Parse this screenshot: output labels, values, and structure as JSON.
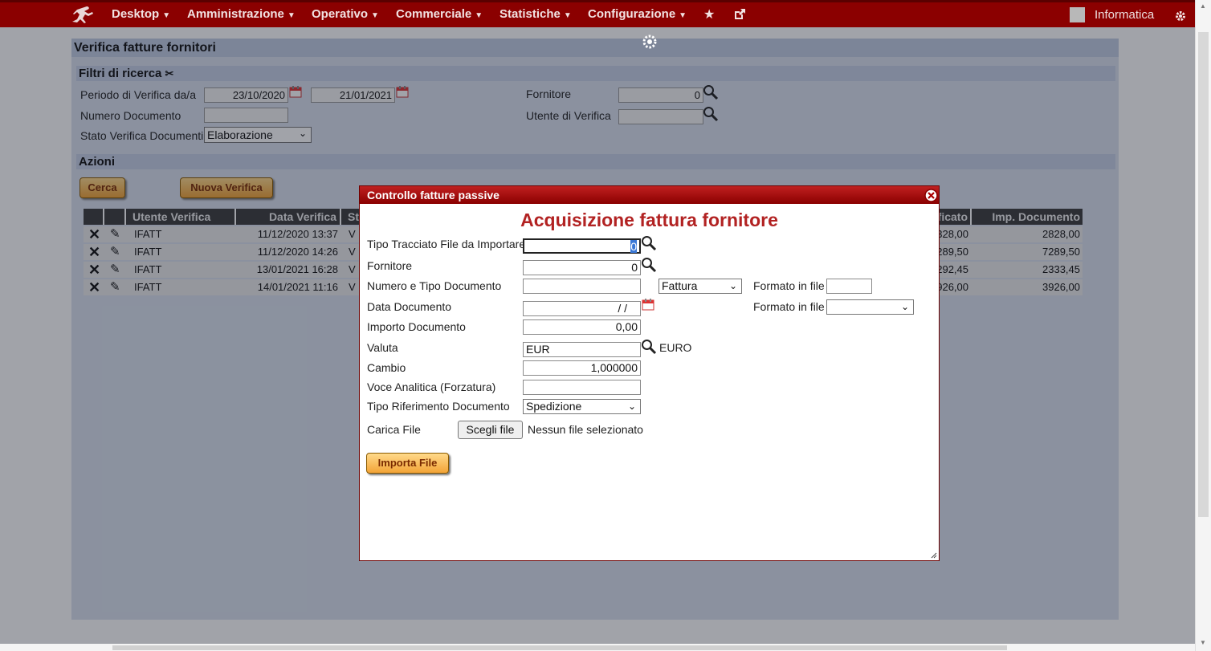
{
  "nav": {
    "items": [
      {
        "label": "Desktop"
      },
      {
        "label": "Amministrazione"
      },
      {
        "label": "Operativo"
      },
      {
        "label": "Commerciale"
      },
      {
        "label": "Statistiche"
      },
      {
        "label": "Configurazione"
      }
    ],
    "user": "Informatica"
  },
  "page": {
    "title": "Verifica fatture fornitori",
    "filters": {
      "heading": "Filtri di ricerca",
      "periodo_label": "Periodo di Verifica da/a",
      "date_from": "23/10/2020",
      "date_to": "21/01/2021",
      "numero_label": "Numero Documento",
      "numero_value": "",
      "stato_label": "Stato Verifica Documenti",
      "stato_value": "Elaborazione",
      "fornitore_label": "Fornitore",
      "fornitore_value": "0",
      "utente_label": "Utente di Verifica",
      "utente_value": ""
    },
    "actions": {
      "heading": "Azioni",
      "cerca": "Cerca",
      "nuova": "Nuova Verifica"
    },
    "table": {
      "headers": {
        "utente": "Utente Verifica",
        "data": "Data Verifica",
        "stato": "St",
        "verificato": "ficato",
        "importo": "Imp. Documento"
      },
      "rows": [
        {
          "utente": "IFATT",
          "data": "11/12/2020 13:37",
          "stato": "V",
          "verificato": "328,00",
          "importo": "2828,00"
        },
        {
          "utente": "IFATT",
          "data": "11/12/2020 14:26",
          "stato": "V",
          "verificato": "289,50",
          "importo": "7289,50"
        },
        {
          "utente": "IFATT",
          "data": "13/01/2021 16:28",
          "stato": "V",
          "verificato": "292,45",
          "importo": "2333,45"
        },
        {
          "utente": "IFATT",
          "data": "14/01/2021 11:16",
          "stato": "V",
          "verificato": "926,00",
          "importo": "3926,00"
        }
      ]
    }
  },
  "dialog": {
    "title": "Controllo fatture passive",
    "heading": "Acquisizione fattura fornitore",
    "tipo_tracciato_label": "Tipo Tracciato File da Importare",
    "tipo_tracciato_value": "0",
    "fornitore_label": "Fornitore",
    "fornitore_value": "0",
    "numero_tipo_label": "Numero e Tipo Documento",
    "numero_value": "",
    "tipo_doc_value": "Fattura",
    "formato_label_1": "Formato in file",
    "formato_value_1": "",
    "data_label": "Data Documento",
    "data_value": " /  /",
    "formato_label_2": "Formato in file",
    "formato_value_2": "",
    "importo_label": "Importo Documento",
    "importo_value": "0,00",
    "valuta_label": "Valuta",
    "valuta_value": "EUR",
    "valuta_desc": "EURO",
    "cambio_label": "Cambio",
    "cambio_value": "1,000000",
    "voce_label": "Voce Analitica (Forzatura)",
    "voce_value": "",
    "tipo_rif_label": "Tipo Riferimento Documento",
    "tipo_rif_value": "Spedizione",
    "carica_label": "Carica File",
    "file_button": "Scegli file",
    "file_status": "Nessun file selezionato",
    "importa_button": "Importa File"
  }
}
